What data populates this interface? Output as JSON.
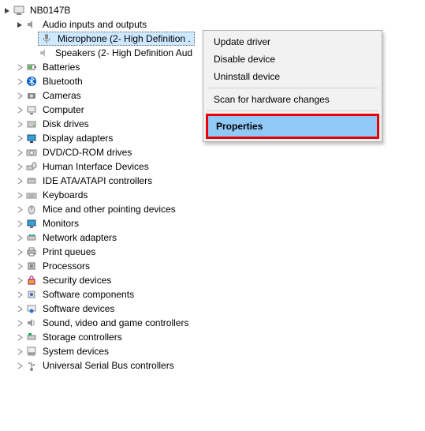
{
  "root": {
    "label": "NB0147B"
  },
  "audio": {
    "label": "Audio inputs and outputs",
    "mic": "Microphone (2- High Definition .",
    "speakers": "Speakers (2- High Definition Aud"
  },
  "nodes": {
    "batteries": "Batteries",
    "bluetooth": "Bluetooth",
    "cameras": "Cameras",
    "computer": "Computer",
    "disk": "Disk drives",
    "display": "Display adapters",
    "dvd": "DVD/CD-ROM drives",
    "hid": "Human Interface Devices",
    "ide": "IDE ATA/ATAPI controllers",
    "keyboards": "Keyboards",
    "mice": "Mice and other pointing devices",
    "monitors": "Monitors",
    "network": "Network adapters",
    "print": "Print queues",
    "processors": "Processors",
    "security": "Security devices",
    "swcomp": "Software components",
    "swdev": "Software devices",
    "sound": "Sound, video and game controllers",
    "storage": "Storage controllers",
    "system": "System devices",
    "usb": "Universal Serial Bus controllers"
  },
  "menu": {
    "update": "Update driver",
    "disable": "Disable device",
    "uninstall": "Uninstall device",
    "scan": "Scan for hardware changes",
    "properties": "Properties"
  }
}
